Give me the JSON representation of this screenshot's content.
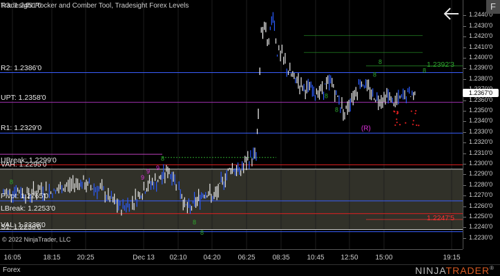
{
  "title": "Tradesight Rocker and Comber Tool, Tradesight Forex Levels",
  "price_label": "R3: 1.2451'0",
  "copyright": "© 2022 NinjaTrader, LLC",
  "instrument_tab": "Forex",
  "brand": {
    "prefix": "NINJA",
    "suffix": "TRADER",
    "mark": "®"
  },
  "f_button": "F",
  "current_price": "1.2367'0",
  "levels": [
    {
      "label": "R2: 1.2386'0",
      "value": 1.2386,
      "color": "#3a5fff"
    },
    {
      "label": "UPT: 1.2358'0",
      "value": 1.2358,
      "color": "#a030b0"
    },
    {
      "label": "R1: 1.2329'0",
      "value": 1.2329,
      "color": "#3a5fff"
    },
    {
      "label": "UBreak: 1.2299'0",
      "value": 1.2299,
      "color": "#e02020"
    },
    {
      "label": "VAH: 1.2295'0",
      "value": 1.2295,
      "color": "#c8c8c8"
    },
    {
      "label": "Pivot: 1.2265'0",
      "value": 1.2265,
      "color": "#3a5fff"
    },
    {
      "label": "LBreak: 1.2253'0",
      "value": 1.2253,
      "color": "#e02020"
    },
    {
      "label": "VAL: 1.2238'0",
      "value": 1.2238,
      "color": "#c8c8c8"
    },
    {
      "label": "S1: 1.2236'0",
      "value": 1.2236,
      "color": "#3a5fff"
    }
  ],
  "right_labels": [
    {
      "label": "1.2392'3",
      "value": 1.23923,
      "color": "#2ea82e"
    },
    {
      "label": "1.2247'5",
      "value": 1.22475,
      "color": "#ff3030"
    }
  ],
  "marker_r": "(R)",
  "chart_data": {
    "type": "candlestick",
    "ylim": [
      1.2226,
      1.2448
    ],
    "yticks": [
      "1.2440'0",
      "1.2430'0",
      "1.2420'0",
      "1.2410'0",
      "1.2400'0",
      "1.2390'0",
      "1.2380'0",
      "1.2370'0",
      "1.2360'0",
      "1.2350'0",
      "1.2340'0",
      "1.2330'0",
      "1.2320'0",
      "1.2310'0",
      "1.2300'0",
      "1.2290'0",
      "1.2280'0",
      "1.2270'0",
      "1.2260'0",
      "1.2250'0",
      "1.2240'0",
      "1.2230'0"
    ],
    "ytick_values": [
      1.244,
      1.243,
      1.242,
      1.241,
      1.24,
      1.239,
      1.238,
      1.237,
      1.236,
      1.235,
      1.234,
      1.233,
      1.232,
      1.231,
      1.23,
      1.229,
      1.228,
      1.227,
      1.226,
      1.225,
      1.224,
      1.223
    ],
    "xticks": [
      "16:05",
      "18:15",
      "20:25",
      "Dec 13",
      "02:10",
      "04:20",
      "06:25",
      "08:35",
      "10:45",
      "12:50",
      "15:00",
      "19:15"
    ],
    "price_path": [
      [
        0,
        1.2272
      ],
      [
        0.03,
        1.2275
      ],
      [
        0.06,
        1.2271
      ],
      [
        0.09,
        1.2276
      ],
      [
        0.12,
        1.2273
      ],
      [
        0.15,
        1.2279
      ],
      [
        0.18,
        1.2283
      ],
      [
        0.2,
        1.2279
      ],
      [
        0.23,
        1.2276
      ],
      [
        0.26,
        1.2264
      ],
      [
        0.28,
        1.2258
      ],
      [
        0.31,
        1.2266
      ],
      [
        0.33,
        1.2274
      ],
      [
        0.35,
        1.2282
      ],
      [
        0.37,
        1.2284
      ],
      [
        0.39,
        1.2294
      ],
      [
        0.41,
        1.2284
      ],
      [
        0.42,
        1.2274
      ],
      [
        0.43,
        1.2262
      ],
      [
        0.44,
        1.2256
      ],
      [
        0.46,
        1.2266
      ],
      [
        0.48,
        1.2274
      ],
      [
        0.5,
        1.2267
      ],
      [
        0.52,
        1.2283
      ],
      [
        0.54,
        1.2297
      ],
      [
        0.56,
        1.2292
      ],
      [
        0.58,
        1.2303
      ],
      [
        0.6,
        1.2309
      ],
      [
        0.605,
        1.2345
      ],
      [
        0.612,
        1.2428
      ],
      [
        0.63,
        1.2419
      ],
      [
        0.64,
        1.2441
      ],
      [
        0.65,
        1.2406
      ],
      [
        0.665,
        1.2399
      ],
      [
        0.68,
        1.2384
      ],
      [
        0.7,
        1.2378
      ],
      [
        0.72,
        1.2371
      ],
      [
        0.74,
        1.2366
      ],
      [
        0.76,
        1.2372
      ],
      [
        0.78,
        1.2376
      ],
      [
        0.8,
        1.2356
      ],
      [
        0.81,
        1.2349
      ],
      [
        0.83,
        1.2364
      ],
      [
        0.85,
        1.2378
      ],
      [
        0.87,
        1.2367
      ],
      [
        0.89,
        1.2361
      ],
      [
        0.91,
        1.2364
      ],
      [
        0.93,
        1.2358
      ],
      [
        0.96,
        1.2366
      ],
      [
        0.98,
        1.2366
      ]
    ]
  }
}
